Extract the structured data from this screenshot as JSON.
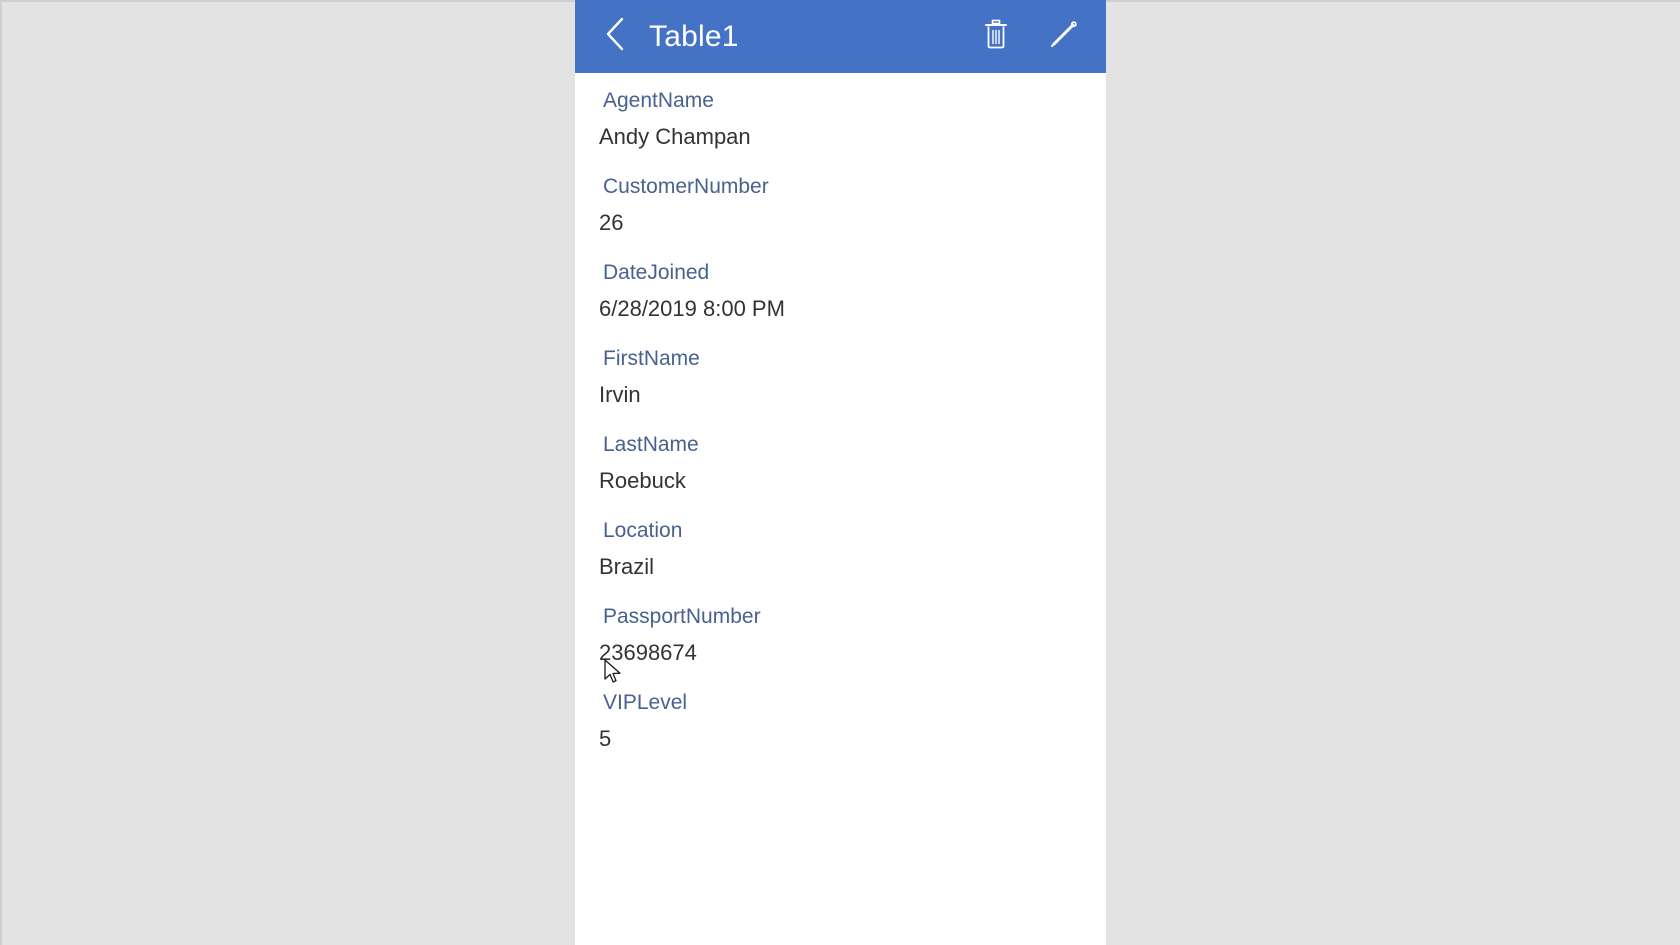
{
  "window": {
    "background_color": "#e3e3e3",
    "panel_background": "#ffffff"
  },
  "header": {
    "title": "Table1",
    "background_color": "#4472c4",
    "back_icon": "chevron-left-icon",
    "delete_icon": "trash-icon",
    "edit_icon": "pencil-icon"
  },
  "form": {
    "label_color": "#48618f",
    "value_color": "#333333",
    "fields": [
      {
        "label": "AgentName",
        "value": "Andy Champan"
      },
      {
        "label": "CustomerNumber",
        "value": "26"
      },
      {
        "label": "DateJoined",
        "value": "6/28/2019 8:00 PM"
      },
      {
        "label": "FirstName",
        "value": "Irvin"
      },
      {
        "label": "LastName",
        "value": "Roebuck"
      },
      {
        "label": "Location",
        "value": "Brazil"
      },
      {
        "label": "PassportNumber",
        "value": "23698674"
      },
      {
        "label": "VIPLevel",
        "value": "5"
      }
    ]
  }
}
